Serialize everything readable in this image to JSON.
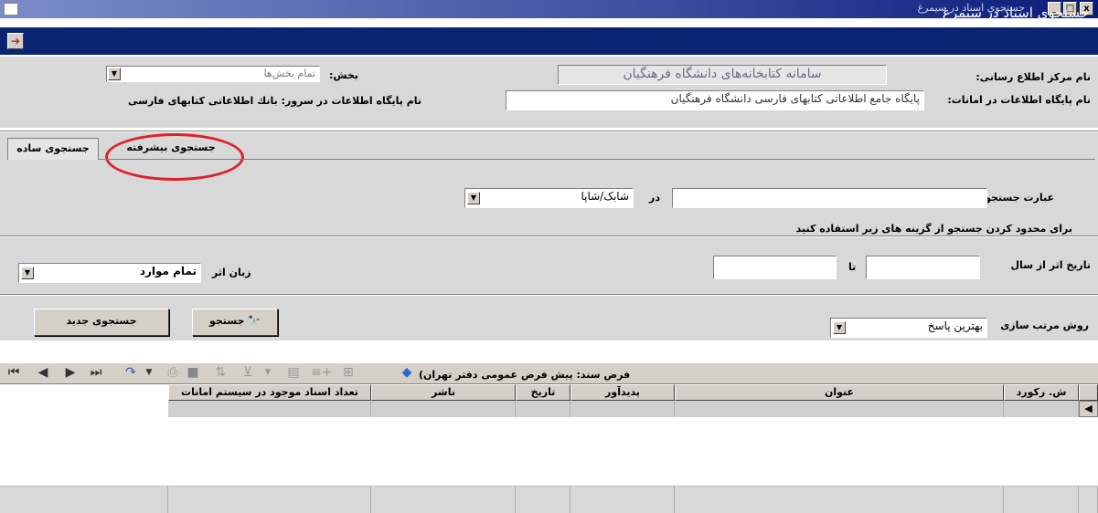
{
  "window": {
    "title": "جستجوي اسناد در سيمرغ",
    "min": "_",
    "max": "□",
    "close": "x"
  },
  "header": {
    "title": "جستجوي اسناد در سيمرغ",
    "exit_icon": "exit-door-icon"
  },
  "info": {
    "center_label": "نام مرکز اطلاع رسانی:",
    "center_value": "سامانه کتابخانه‌های دانشگاه فرهنگیان",
    "db_label": "نام پایگاه اطلاعات در امانات:",
    "db_value": "پایگاه جامع اطلاعاتی کتابهای فارسی دانشگاه فرهنگیان",
    "section_label": "بخش:",
    "section_value": "تمام بخش‌ها",
    "server_db_label": "نام پایگاه اطلاعات در سرور:",
    "server_db_value": "بانك اطلاعاتی کتابهای فارسی"
  },
  "tabs": {
    "simple": "جستجوی ساده",
    "advanced": "جستجوی بیشرفته"
  },
  "search": {
    "query_label": "عبارت جستجو",
    "query_value": "",
    "in_label": "در",
    "field_value": "شابک/شاپا",
    "limit_note": "برای محدود کردن جستجو از گزینه های زیر استفاده کنید",
    "date_from_label": "تاریخ اثر از سال",
    "date_to_label": "تا",
    "date_from_value": "",
    "date_to_value": "",
    "language_label": "زبان اثر",
    "language_value": "تمام موارد",
    "sort_label": "روش مرتب سازی",
    "sort_value": "بهترین پاسخ",
    "search_button": "جستجو",
    "new_search_button": "جستجوی جدید"
  },
  "toolbar": {
    "default_doc": "فرض سند: پیش فرض عمومی دفتر تهران)"
  },
  "grid": {
    "columns": [
      "ش. رکورد",
      "عنوان",
      "پدیدآور",
      "تاریخ",
      "ناشر",
      "تعداد اسناد موجود در سیستم امانات"
    ]
  },
  "colors": {
    "header_bg": "#0b2472",
    "panel_bg": "#d8d8d8",
    "highlight_circle": "#e0202a"
  }
}
